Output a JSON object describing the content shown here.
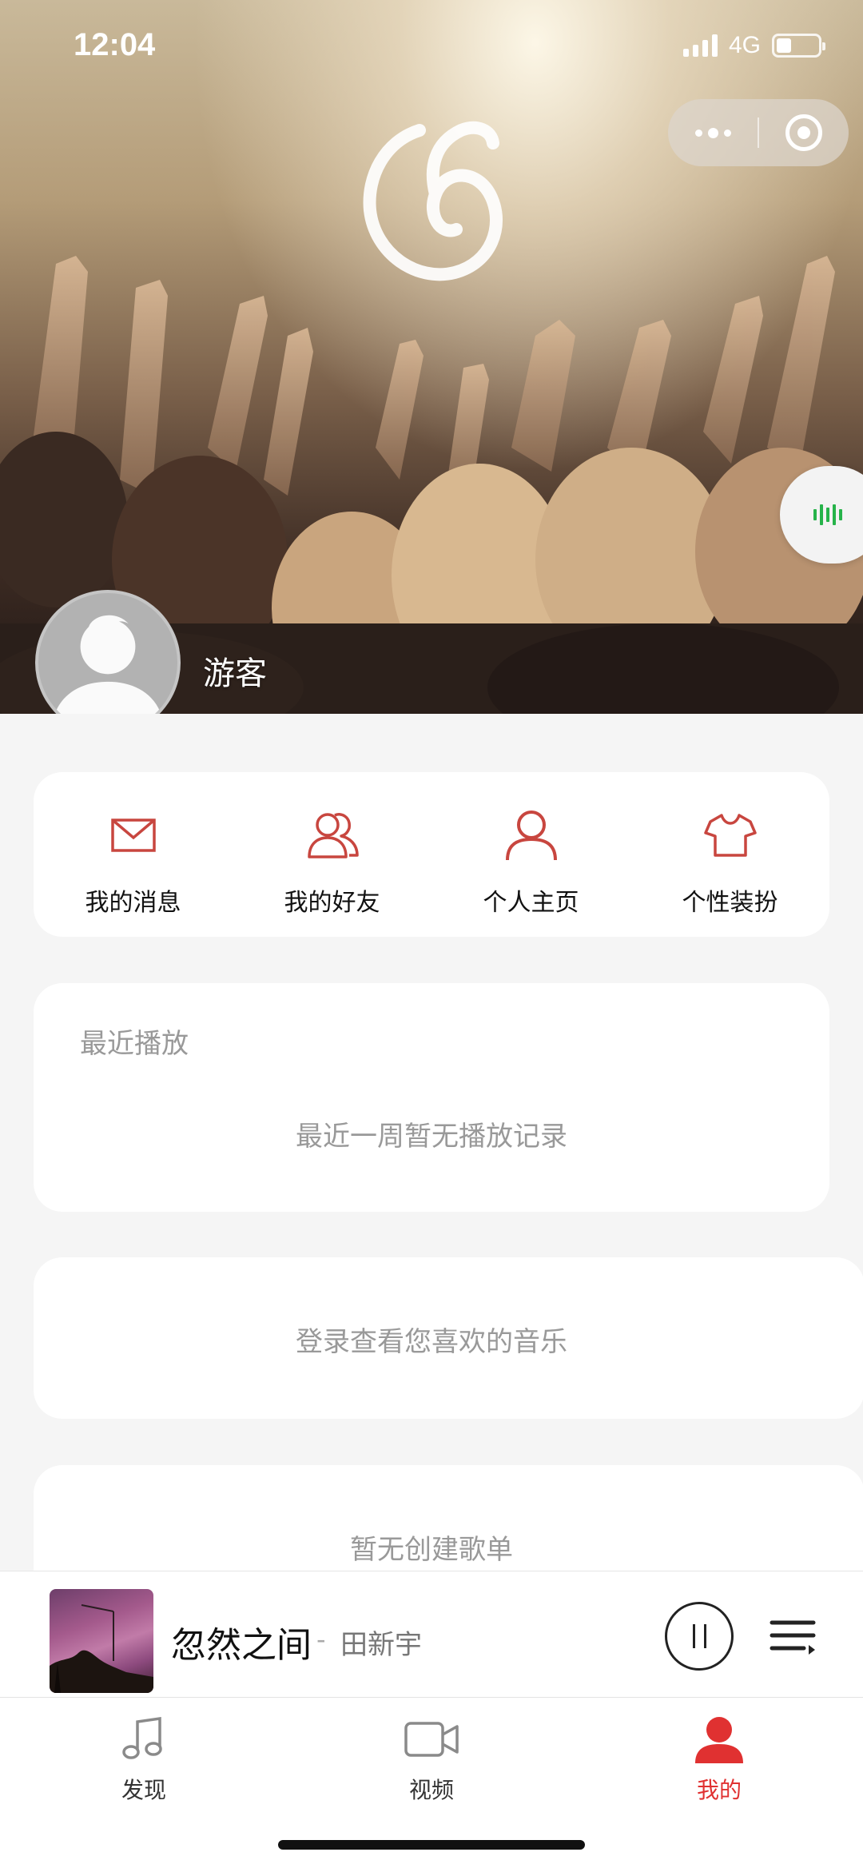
{
  "status_bar": {
    "time": "12:04",
    "network": "4G",
    "battery_level": 0.35
  },
  "header": {
    "username": "游客",
    "logo_icon": "netease-music-logo-icon",
    "capsule": {
      "more_icon": "more-dots-icon",
      "close_icon": "target-circle-icon"
    },
    "float_icon": "audio-wave-icon"
  },
  "quick_actions": [
    {
      "label": "我的消息",
      "icon": "envelope-icon"
    },
    {
      "label": "我的好友",
      "icon": "friends-icon"
    },
    {
      "label": "个人主页",
      "icon": "person-icon"
    },
    {
      "label": "个性装扮",
      "icon": "tshirt-icon"
    }
  ],
  "recent": {
    "title": "最近播放",
    "empty_text": "最近一周暂无播放记录"
  },
  "favorites": {
    "message": "登录查看您喜欢的音乐"
  },
  "playlists": {
    "message": "暂无创建歌单"
  },
  "player": {
    "song": "忽然之间",
    "separator": "-",
    "artist": "田新宇",
    "state": "playing"
  },
  "tabbar": {
    "items": [
      {
        "label": "发现",
        "icon": "music-note-icon",
        "active": false
      },
      {
        "label": "视频",
        "icon": "video-camera-icon",
        "active": false
      },
      {
        "label": "我的",
        "icon": "user-filled-icon",
        "active": true
      }
    ]
  },
  "colors": {
    "accent": "#e03131",
    "icon_red": "#c8463f",
    "background": "#f5f5f5"
  }
}
